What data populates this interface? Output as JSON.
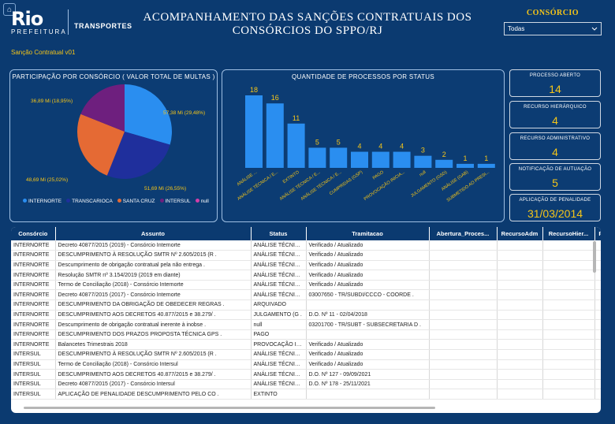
{
  "header": {
    "logo_name": "Rio",
    "logo_sub": "PREFEITURA",
    "logo_dept": "TRANSPORTES",
    "title_line1": "ACOMPANHAMENTO DAS SANÇÕES CONTRATUAIS DOS",
    "title_line2": "CONSÓRCIOS DO SPPO/RJ",
    "consorcio_label": "CONSÓRCIO",
    "consorcio_value": "Todas",
    "page_label": "Sanção Contratual v01"
  },
  "pie_panel": {
    "title": "PARTICIPAÇÃO POR CONSÓRCIO ( VALOR TOTAL DE MULTAS )",
    "labels": [
      "57,38 Mi (29,48%)",
      "51,69 Mi (26,55%)",
      "48,69 Mi (25,02%)",
      "36,89 Mi (18,95%)"
    ],
    "legend": [
      "INTERNORTE",
      "TRANSCARIOCA",
      "SANTA CRUZ",
      "INTERSUL",
      "null"
    ]
  },
  "bar_panel": {
    "title": "QUANTIDADE DE PROCESSOS POR STATUS"
  },
  "chart_data": [
    {
      "type": "pie",
      "title": "PARTICIPAÇÃO POR CONSÓRCIO ( VALOR TOTAL DE MULTAS )",
      "categories": [
        "INTERNORTE",
        "TRANSCARIOCA",
        "SANTA CRUZ",
        "INTERSUL",
        "null"
      ],
      "values": [
        57.38,
        51.69,
        48.69,
        36.89,
        0
      ],
      "colors": [
        "#2a8ef0",
        "#1f2f9c",
        "#e56a34",
        "#6e1f7e",
        "#d43ea8"
      ]
    },
    {
      "type": "bar",
      "title": "QUANTIDADE DE PROCESSOS POR STATUS",
      "categories": [
        "ANÁLISE ...",
        "ANÁLISE TÉCNICA / E...",
        "EXTINTO",
        "ANÁLISE TÉCNICA / E...",
        "ANÁLISE TÉCNICA / E...",
        "CUMPRIDAS (GSP)",
        "PAGO",
        "PROVOCAÇÃO INICIA...",
        "null",
        "JULGAMENTO (GSD)",
        "ANÁLISE (GAB)",
        "SUBMETIDO AO PRESI..."
      ],
      "values": [
        18,
        16,
        11,
        5,
        5,
        4,
        4,
        4,
        3,
        2,
        1,
        1
      ],
      "ylim": [
        0,
        20
      ],
      "color": "#2a8ef0"
    }
  ],
  "kpis": [
    {
      "label": "PROCESSO ABERTO",
      "value": "14"
    },
    {
      "label": "RECURSO HIERÁRQUICO",
      "value": "4"
    },
    {
      "label": "RECURSO ADMINISTRATIVO",
      "value": "4"
    },
    {
      "label": "NOTIFICAÇÃO DE AUTUAÇÃO",
      "value": "5"
    },
    {
      "label": "APLICAÇÃO DE PENALIDADE",
      "value": "31/03/2014"
    }
  ],
  "table": {
    "columns": [
      "Consórcio",
      "Assunto",
      "Status",
      "Tramitacao",
      "Abertura_Proces...",
      "RecursoAdm",
      "RecursoHier...",
      "Pe"
    ],
    "rows": [
      [
        "INTERNORTE",
        "Decreto 40877/2015 (2019) - Consórcio Internorte",
        "ANÁLISE TÉCNICA .",
        "Verificado / Atualizado"
      ],
      [
        "INTERNORTE",
        "DESCUMPRIMENTO À RESOLUÇÃO SMTR Nº 2.605/2015 (R .",
        "ANÁLISE TÉCNICA .",
        "Verificado / Atualizado"
      ],
      [
        "INTERNORTE",
        "Descumprimento de obrigação contratual pela não entrega .",
        "ANÁLISE TÉCNICA .",
        "Verificado / Atualizado"
      ],
      [
        "INTERNORTE",
        "Resolução SMTR nº 3.154/2019 (2019 em diante)",
        "ANÁLISE TÉCNICA .",
        "Verificado / Atualizado"
      ],
      [
        "INTERNORTE",
        "Termo de Conciliação (2018) - Consórcio Internorte",
        "ANÁLISE TÉCNICA .",
        "Verificado / Atualizado"
      ],
      [
        "INTERNORTE",
        "Decreto 40877/2015 (2017) - Consórcio Internorte",
        "ANÁLISE TÉCNICA .",
        "03007650 - TR/SUBDI/CCCO - COORDE ."
      ],
      [
        "INTERNORTE",
        "DESCUMPRIMENTO DA OBRIGAÇÃO DE OBEDECER REGRAS .",
        "ARQUIVADO",
        ""
      ],
      [
        "INTERNORTE",
        "DESCUMPRIMENTO AOS DECRETOS 40.877/2015 e 38.279/ .",
        "JULGAMENTO (G .",
        "D.O. Nº 11 - 02/04/2018"
      ],
      [
        "INTERNORTE",
        "Descumprimento de obrigação contratual inerente à inobse .",
        "null",
        "03201700 - TR/SUBT - SUBSECRETARIA D ."
      ],
      [
        "INTERNORTE",
        "DESCUMPRIMENTO DOS PRAZOS PROPOSTA TÉCNICA GPS .",
        "PAGO",
        ""
      ],
      [
        "INTERNORTE",
        "Balancetes Trimestrais 2018",
        "PROVOCAÇÃO INI .",
        "Verificado / Atualizado"
      ],
      [
        "INTERSUL",
        "DESCUMPRIMENTO À RESOLUÇÃO SMTR Nº 2.605/2015 (R .",
        "ANÁLISE TÉCNICA .",
        "Verificado / Atualizado"
      ],
      [
        "INTERSUL",
        "Termo de Conciliação (2018) - Consórcio Intersul",
        "ANÁLISE TÉCNICA .",
        "Verificado / Atualizado"
      ],
      [
        "INTERSUL",
        "DESCUMPRIMENTO AOS DECRETOS 40.877/2015 e 38.279/ .",
        "ANÁLISE TÉCNICA .",
        "D.O. Nº 127 - 09/09/2021"
      ],
      [
        "INTERSUL",
        "Decreto 40877/2015 (2017) - Consórcio Intersul",
        "ANÁLISE TÉCNICA .",
        "D.O. Nº 178 - 25/11/2021"
      ],
      [
        "INTERSUL",
        "APLICAÇÃO DE PENALIDADE DESCUMPRIMENTO PELO CO .",
        "EXTINTO",
        ""
      ]
    ]
  }
}
